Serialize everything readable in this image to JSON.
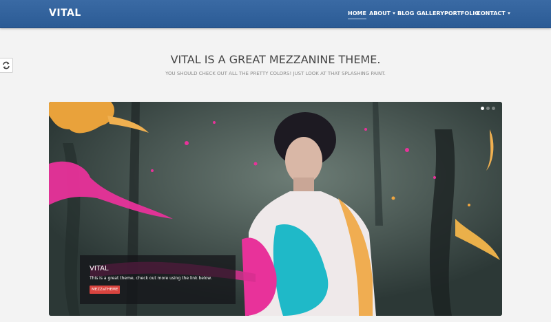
{
  "brand": {
    "name": "VITAL"
  },
  "nav": {
    "items": [
      {
        "label": "HOME",
        "active": true,
        "dropdown": false
      },
      {
        "label": "ABOUT",
        "active": false,
        "dropdown": true
      },
      {
        "label": "BLOG",
        "active": false,
        "dropdown": false
      },
      {
        "label": "GALLERY",
        "active": false,
        "dropdown": false
      },
      {
        "label": "PORTFOLIO",
        "active": false,
        "dropdown": false
      },
      {
        "label": "CONTACT",
        "active": false,
        "dropdown": true
      }
    ]
  },
  "side_button": {
    "icon": "refresh-icon"
  },
  "intro": {
    "title": "VITAL IS A GREAT MEZZANINE THEME.",
    "subtitle": "YOU SHOULD CHECK OUT ALL THE PRETTY COLORS! JUST LOOK AT THAT SPLASHING PAINT."
  },
  "slider": {
    "slide_count": 3,
    "active_slide": 1,
    "caption": {
      "title": "VITAL",
      "text": "This is a great theme, check out more using the link below.",
      "button_label": "MEZZaTHEME"
    }
  },
  "colors": {
    "navbar": "#2e5e98",
    "background": "#f3f3f3",
    "caption_button": "#d9443f",
    "paint_pink": "#e8329a",
    "paint_cyan": "#1fb9c8",
    "paint_orange": "#f0a640"
  }
}
